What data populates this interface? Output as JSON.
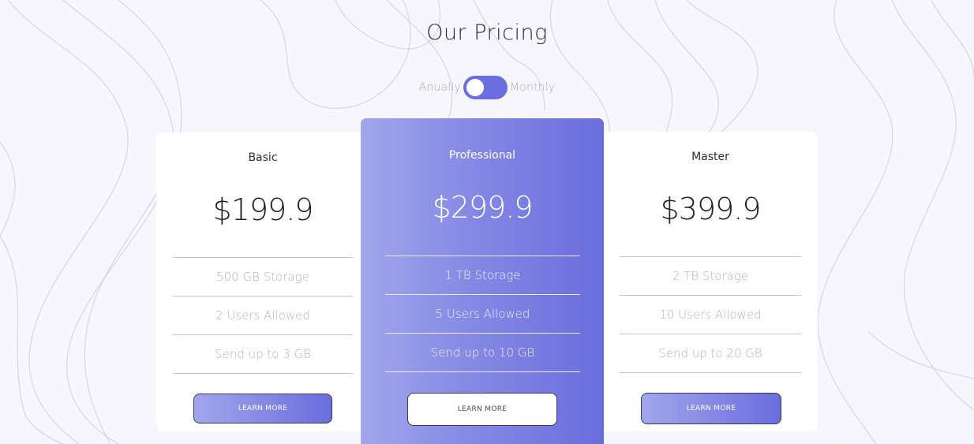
{
  "header": {
    "title": "Our Pricing",
    "toggle": {
      "left_label": "Anually",
      "right_label": "Monthly",
      "state": "annually"
    }
  },
  "colors": {
    "accent": "#6b6fde",
    "gradient_start": "#a2a6ec",
    "gradient_end": "#6a6ddd",
    "background": "#f6f6fc"
  },
  "plans": [
    {
      "name": "Basic",
      "price": "$199.9",
      "features": [
        "500 GB Storage",
        "2 Users Allowed",
        "Send up to 3 GB"
      ],
      "button_label": "LEARN MORE"
    },
    {
      "name": "Professional",
      "price": "$299.9",
      "features": [
        "1 TB Storage",
        "5 Users Allowed",
        "Send up to 10 GB"
      ],
      "button_label": "LEARN MORE"
    },
    {
      "name": "Master",
      "price": "$399.9",
      "features": [
        "2 TB Storage",
        "10 Users Allowed",
        "Send up to 20 GB"
      ],
      "button_label": "LEARN MORE"
    }
  ]
}
